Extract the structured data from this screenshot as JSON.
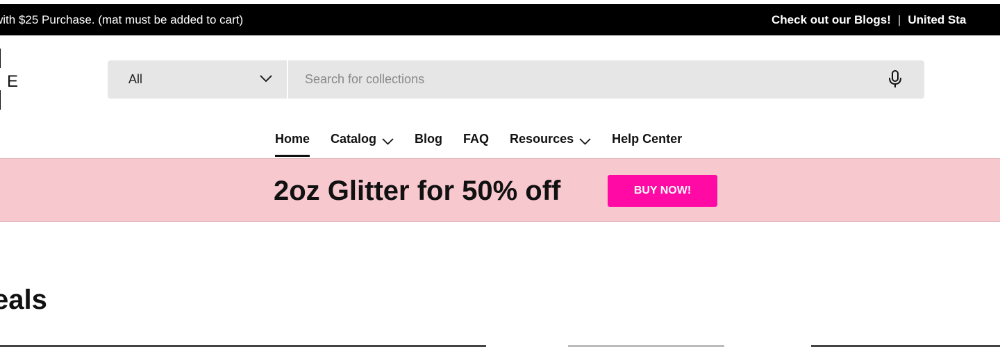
{
  "topbar": {
    "announcement": "with $25 Purchase. (mat must be added to cart)",
    "blogs_link": "Check out our Blogs!",
    "separator": "|",
    "region_link": "United Sta"
  },
  "logo": {
    "letter": "E"
  },
  "search": {
    "category_label": "All",
    "placeholder": "Search for collections",
    "value": ""
  },
  "nav": {
    "items": [
      {
        "label": "Home"
      },
      {
        "label": "Catalog"
      },
      {
        "label": "Blog"
      },
      {
        "label": "FAQ"
      },
      {
        "label": "Resources"
      },
      {
        "label": "Help Center"
      }
    ]
  },
  "promo": {
    "text": "2oz Glitter for 50% off",
    "button_label": "BUY NOW!",
    "background_color": "#f8c8cf",
    "button_color": "#ff0aa5"
  },
  "section": {
    "title": "eals"
  },
  "icons": {
    "category_chevron": "chevron-down-icon",
    "mic": "microphone-icon"
  }
}
